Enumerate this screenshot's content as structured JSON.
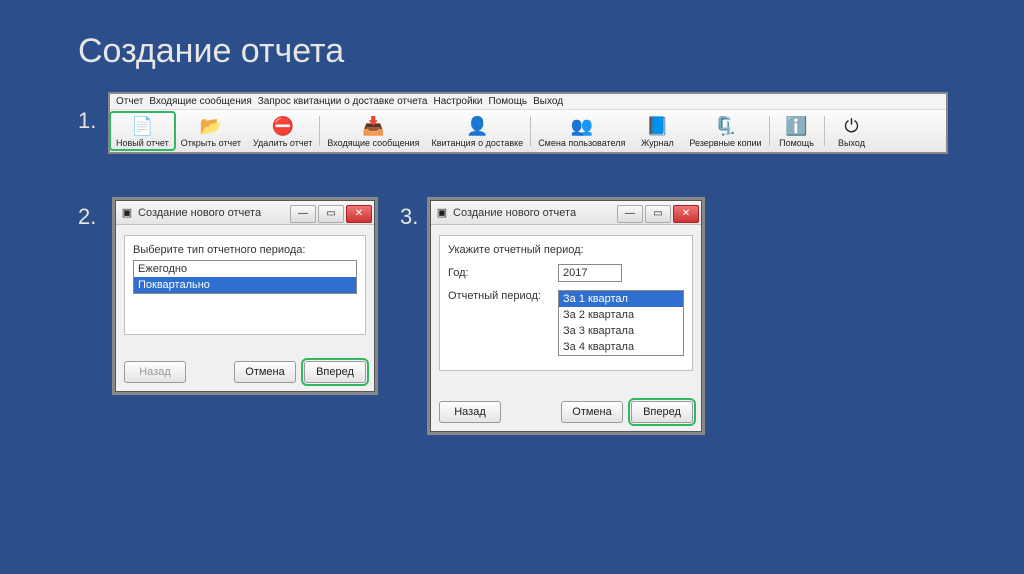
{
  "slide": {
    "title": "Создание отчета",
    "steps": [
      "1.",
      "2.",
      "3."
    ]
  },
  "menu": {
    "items": [
      "Отчет",
      "Входящие сообщения",
      "Запрос квитанции о доставке отчета",
      "Настройки",
      "Помощь",
      "Выход"
    ]
  },
  "toolbar": {
    "items": [
      {
        "label": "Новый отчет",
        "icon": "📄",
        "highlight": true
      },
      {
        "label": "Открыть отчет",
        "icon": "📂"
      },
      {
        "label": "Удалить отчет",
        "icon": "⛔"
      },
      {
        "label": "Входящие сообщения",
        "icon": "📥"
      },
      {
        "label": "Квитанция о доставке",
        "icon": "👤"
      },
      {
        "label": "Смена пользователя",
        "icon": "👥"
      },
      {
        "label": "Журнал",
        "icon": "📘"
      },
      {
        "label": "Резервные копии",
        "icon": "🗜️"
      },
      {
        "label": "Помощь",
        "icon": "ℹ️"
      },
      {
        "label": "Выход",
        "icon": "⏻"
      }
    ]
  },
  "dialog2": {
    "title": "Создание нового отчета",
    "prompt": "Выберите тип отчетного периода:",
    "options": [
      "Ежегодно",
      "Поквартально"
    ],
    "selected": 1,
    "buttons": {
      "back": "Назад",
      "cancel": "Отмена",
      "next": "Вперед"
    }
  },
  "dialog3": {
    "title": "Создание нового отчета",
    "prompt": "Укажите отчетный период:",
    "year_label": "Год:",
    "year_value": "2017",
    "period_label": "Отчетный период:",
    "periods": [
      "За 1 квартал",
      "За 2 квартала",
      "За 3 квартала",
      "За 4 квартала"
    ],
    "selected": 0,
    "buttons": {
      "back": "Назад",
      "cancel": "Отмена",
      "next": "Вперед"
    }
  },
  "window_controls": {
    "min": "—",
    "max": "▭",
    "close": "✕"
  }
}
